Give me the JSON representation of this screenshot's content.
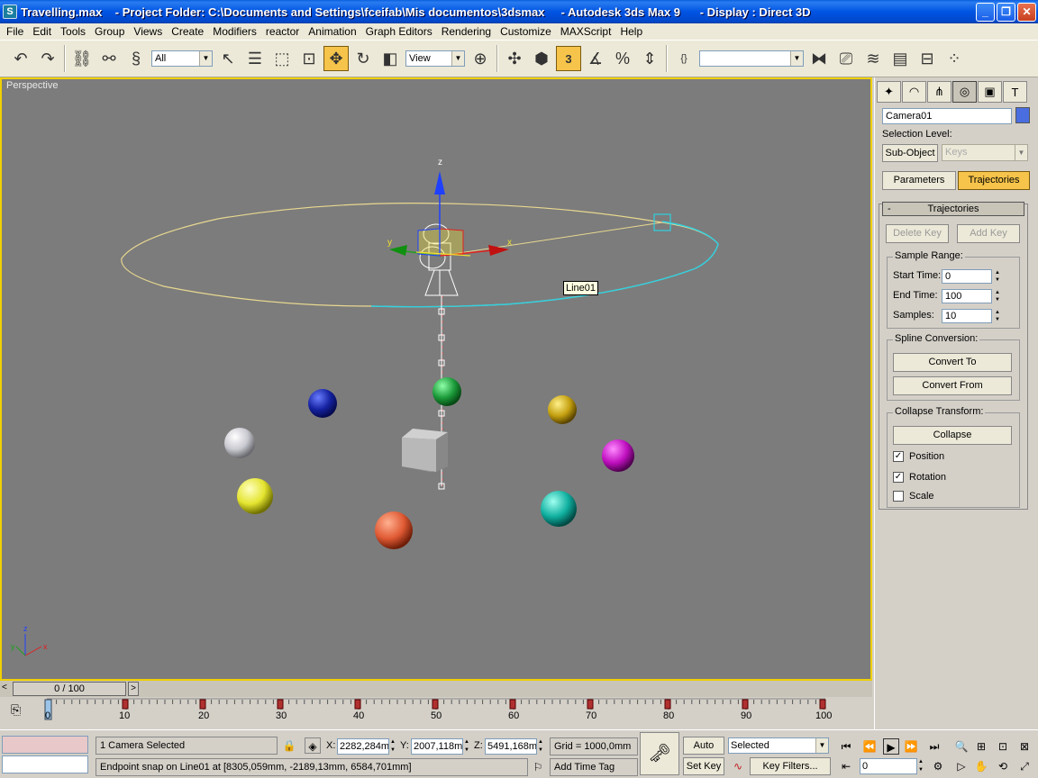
{
  "window": {
    "title": "Travelling.max    - Project Folder: C:\\Documents and Settings\\fceifab\\Mis documentos\\3dsmax     - Autodesk 3ds Max 9      - Display : Direct 3D",
    "minimize": "_",
    "maximize": "❐",
    "close": "✕"
  },
  "menu": [
    "File",
    "Edit",
    "Tools",
    "Group",
    "Views",
    "Create",
    "Modifiers",
    "reactor",
    "Animation",
    "Graph Editors",
    "Rendering",
    "Customize",
    "MAXScript",
    "Help"
  ],
  "toolbar": {
    "selection_filter": "All",
    "reference_coord": "View",
    "snap_value": "3",
    "named_selection": ""
  },
  "viewport": {
    "label": "Perspective",
    "tooltip": "Line01",
    "gizmo_labels": {
      "z": "z",
      "x": "x",
      "y": "y"
    },
    "axis_triad": {
      "z": "z",
      "x": "x",
      "y": "y"
    }
  },
  "command_panel": {
    "object_name": "Camera01",
    "selection_level_label": "Selection Level:",
    "sub_object_label": "Sub-Object",
    "keys_value": "Keys",
    "parameters_label": "Parameters",
    "trajectories_label": "Trajectories",
    "rollout_title": "Trajectories",
    "rollout_collapse": "-",
    "delete_key": "Delete Key",
    "add_key": "Add Key",
    "sample_range_title": "Sample Range:",
    "start_time_label": "Start Time:",
    "start_time_value": "0",
    "end_time_label": "End Time:",
    "end_time_value": "100",
    "samples_label": "Samples:",
    "samples_value": "10",
    "spline_conversion_title": "Spline Conversion:",
    "convert_to": "Convert To",
    "convert_from": "Convert From",
    "collapse_transform_title": "Collapse Transform:",
    "collapse": "Collapse",
    "position_label": "Position",
    "rotation_label": "Rotation",
    "scale_label": "Scale",
    "position_checked": true,
    "rotation_checked": true,
    "scale_checked": false
  },
  "timeline": {
    "slider_text": "0 / 100",
    "prev": "<",
    "next": ">",
    "ticks": [
      "0",
      "10",
      "20",
      "30",
      "40",
      "50",
      "60",
      "70",
      "80",
      "90",
      "100"
    ]
  },
  "status": {
    "selection_info": "1 Camera Selected",
    "prompt": "Endpoint snap on Line01 at [8305,059mm, -2189,13mm, 6584,701mm]",
    "x_label": "X:",
    "x_value": "2282,284mm",
    "y_label": "Y:",
    "y_value": "2007,118mm",
    "z_label": "Z:",
    "z_value": "5491,168mm",
    "grid": "Grid = 1000,0mm",
    "add_time_tag": "Add Time Tag",
    "auto_key": "Auto Key",
    "set_key": "Set Key",
    "key_mode_value": "Selected",
    "key_filters": "Key Filters...",
    "current_frame": "0"
  }
}
